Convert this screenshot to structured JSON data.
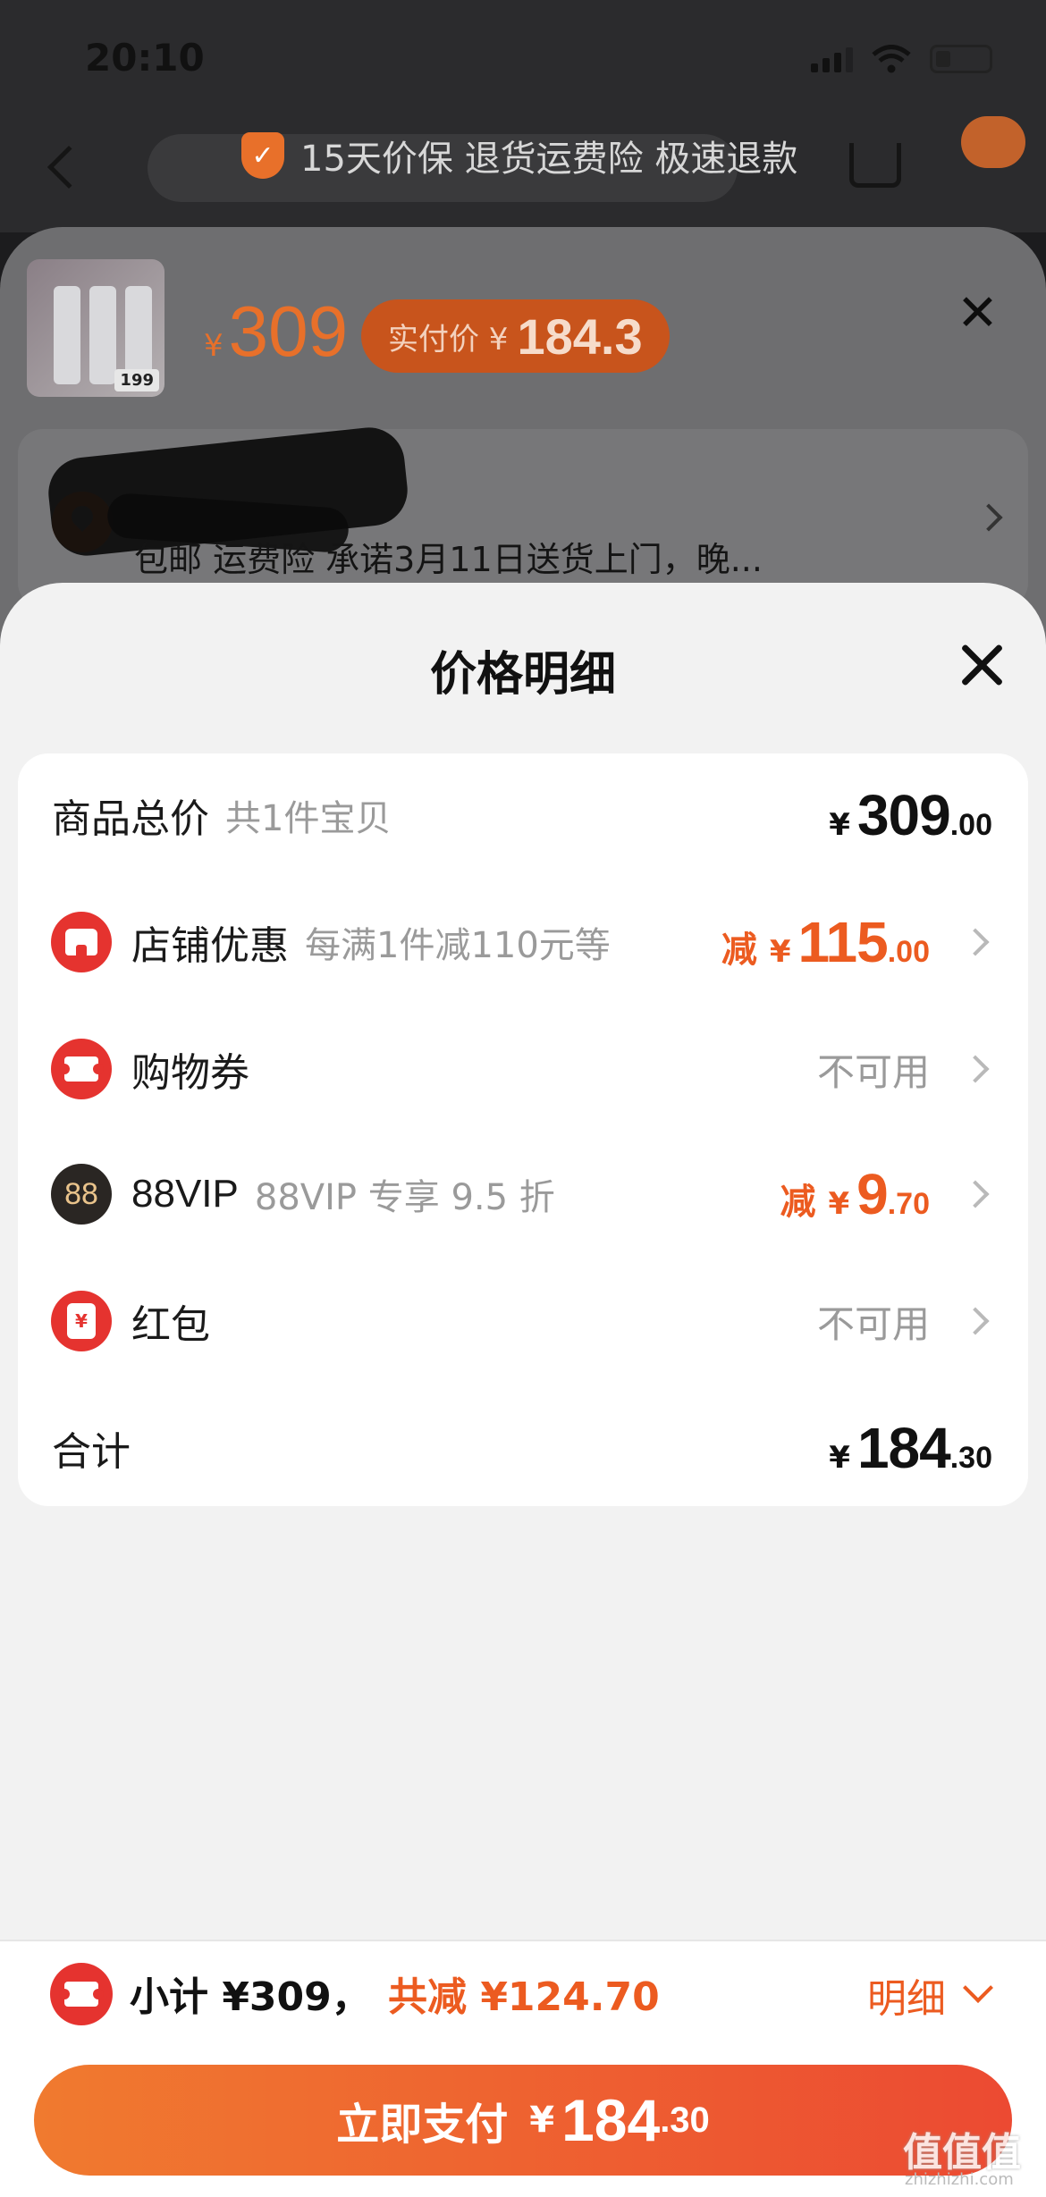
{
  "status_bar": {
    "time": "20:10"
  },
  "header": {
    "guarantee_text": "15天价保 退货运费险 极速退款"
  },
  "product": {
    "thumb_price": "199",
    "price_yen": "¥",
    "price": "309",
    "paid_label": "实付价 ¥",
    "paid_value": "184.3"
  },
  "address": {
    "delivery_text": "包邮  运费险  承诺3月11日送货上门，晚..."
  },
  "price_detail": {
    "title": "价格明细",
    "rows": [
      {
        "label": "商品总价",
        "sub": "共1件宝贝",
        "yen": "¥",
        "int": "309",
        "dec": ".00"
      },
      {
        "label": "店铺优惠",
        "sub": "每满1件减110元等",
        "prefix": "减",
        "yen": "¥",
        "int": "115",
        "dec": ".00",
        "icon": "shop-icon"
      },
      {
        "label": "购物券",
        "status": "不可用",
        "icon": "coupon-icon"
      },
      {
        "label": "88VIP",
        "sub": "88VIP 专享 9.5 折",
        "prefix": "减",
        "yen": "¥",
        "int": "9",
        "dec": ".70",
        "icon": "vip-icon",
        "icon_text": "88"
      },
      {
        "label": "红包",
        "status": "不可用",
        "icon": "red-packet-icon",
        "icon_text": "¥"
      },
      {
        "label": "合计",
        "yen": "¥",
        "int": "184",
        "dec": ".30"
      }
    ]
  },
  "bottom_bar": {
    "subtotal": "小计 ¥309，",
    "discount": "共减 ¥124.70",
    "detail_label": "明细",
    "pay_label": "立即支付",
    "pay_yen": "¥",
    "pay_int": "184",
    "pay_dec": ".30"
  },
  "watermark": {
    "text": "值值值",
    "sub": "zhizhizhi.com"
  },
  "colors": {
    "accent": "#ec5b20",
    "red": "#e5332f",
    "sheet_bg": "#f2f2f2"
  }
}
